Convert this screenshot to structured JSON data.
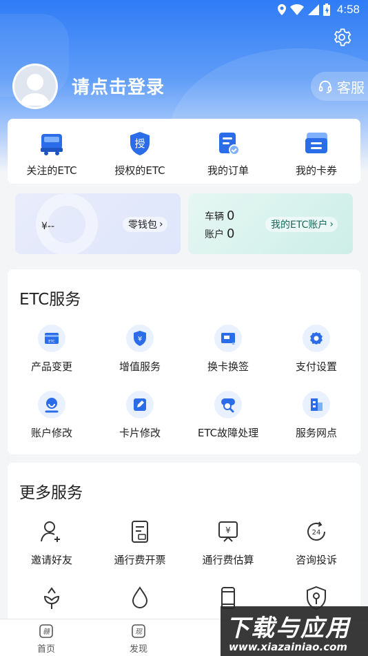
{
  "status_bar": {
    "time": "4:58"
  },
  "header": {
    "login_text": "请点击登录",
    "service_label": "客服"
  },
  "quick_actions": [
    {
      "label": "关注的ETC",
      "icon": "truck-icon"
    },
    {
      "label": "授权的ETC",
      "icon": "authorize-shield-icon",
      "icon_char": "授"
    },
    {
      "label": "我的订单",
      "icon": "order-document-icon"
    },
    {
      "label": "我的卡券",
      "icon": "coupon-card-icon"
    }
  ],
  "wallet": {
    "amount": "¥--",
    "label": "零钱包"
  },
  "etc_account": {
    "vehicle_label": "车辆",
    "vehicle_count": "0",
    "account_label": "账户",
    "account_count": "0",
    "link_label": "我的ETC账户"
  },
  "etc_services": {
    "title": "ETC服务",
    "items": [
      {
        "label": "产品变更",
        "icon": "etc-card-icon"
      },
      {
        "label": "增值服务",
        "icon": "yen-shield-icon"
      },
      {
        "label": "换卡换签",
        "icon": "card-swap-icon"
      },
      {
        "label": "支付设置",
        "icon": "gear-icon"
      },
      {
        "label": "账户修改",
        "icon": "user-edit-icon"
      },
      {
        "label": "卡片修改",
        "icon": "card-edit-icon"
      },
      {
        "label": "ETC故障处理",
        "icon": "search-repair-icon"
      },
      {
        "label": "服务网点",
        "icon": "building-icon"
      }
    ]
  },
  "more_services": {
    "title": "更多服务",
    "items": [
      {
        "label": "邀请好友",
        "icon": "add-user-icon"
      },
      {
        "label": "通行费开票",
        "icon": "invoice-icon"
      },
      {
        "label": "通行费估算",
        "icon": "toll-estimate-icon"
      },
      {
        "label": "咨询投诉",
        "icon": "24h-service-icon"
      },
      {
        "label": "",
        "icon": "flower-icon"
      },
      {
        "label": "",
        "icon": "water-drop-icon"
      },
      {
        "label": "",
        "icon": "phone-icon"
      },
      {
        "label": "",
        "icon": "security-shield-icon"
      }
    ]
  },
  "bottom_nav": [
    {
      "label": "首页",
      "icon": "home-icon"
    },
    {
      "label": "发现",
      "icon": "discover-icon"
    }
  ],
  "watermark": {
    "title": "下载与应用",
    "url": "www.xiazainiao.com"
  },
  "colors": {
    "primary": "#2f7cf6",
    "icon_blue": "#2b6de8",
    "icon_bg": "#eaf1fe",
    "etc_green": "#146a5c"
  }
}
